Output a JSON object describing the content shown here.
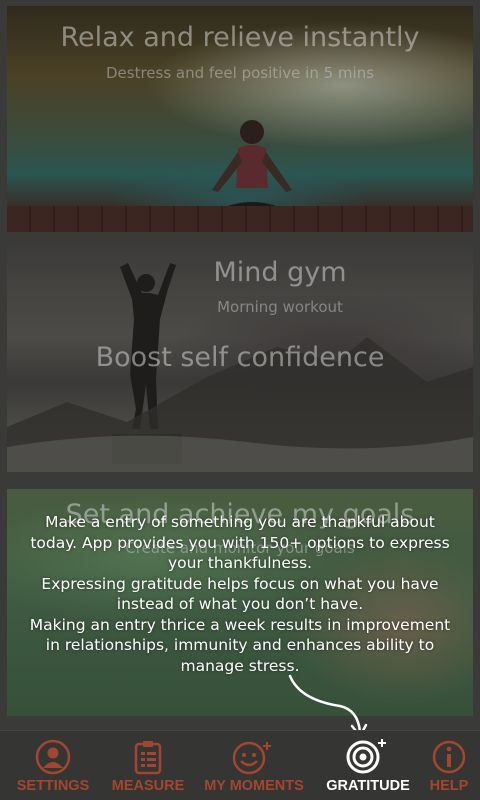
{
  "cards": [
    {
      "title": "Relax and relieve instantly",
      "subtitle": "Destress and feel positive in 5 mins"
    },
    {
      "title": "Mind gym",
      "subtitle": "Morning  workout",
      "title2": "Boost self confidence"
    },
    {
      "title": "Set and achieve my goals",
      "subtitle": "Create and monitor your goals"
    }
  ],
  "tooltip": {
    "lines": [
      "Make a entry of something you are thankful about",
      "today. App provides you with 150+ options to express",
      "your thankfulness.",
      "Expressing gratitude helps focus on what you have",
      "instead of what you don’t have.",
      "Making an entry thrice a week results in improvement",
      "in relationships, immunity and enhances ability to",
      "manage stress."
    ]
  },
  "tabs": [
    {
      "label": "SETTINGS",
      "icon": "person-icon"
    },
    {
      "label": "MEASURE",
      "icon": "clipboard-icon"
    },
    {
      "label": "MY MOMENTS",
      "icon": "smiley-plus-icon"
    },
    {
      "label": "GRATITUDE",
      "icon": "spiral-plus-icon",
      "active": true
    },
    {
      "label": "HELP",
      "icon": "info-icon"
    }
  ],
  "colors": {
    "tab_inactive": "#a2472f",
    "tab_active": "#ffffff",
    "tabbar_bg": "#353533"
  }
}
